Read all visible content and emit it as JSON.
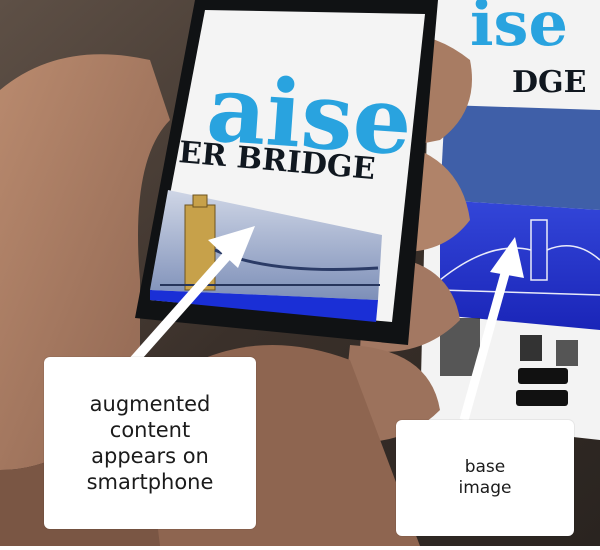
{
  "photo": {
    "phone_screen_headline": "aise",
    "phone_screen_subtitle": "ER BRIDGE",
    "poster_headline": "ise",
    "poster_subtitle": "DGE"
  },
  "annotations": {
    "left": "augmented\ncontent\nappears on\nsmartphone",
    "right": "base\nimage"
  },
  "colors": {
    "headline_cyan": "#29a3df",
    "bridge_blue": "#1a2fd6",
    "callout_bg": "#ffffff",
    "arrow": "#ffffff"
  }
}
